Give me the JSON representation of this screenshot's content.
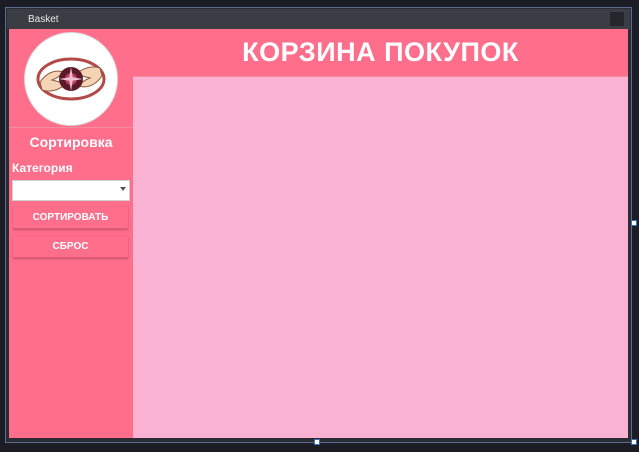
{
  "window": {
    "title": "Basket"
  },
  "sidebar": {
    "logo_icon": "hands-eye-logo",
    "sort_heading": "Сортировка",
    "category_label": "Категория",
    "category_select": {
      "value": ""
    },
    "sort_button": "СОРТИРОВАТЬ",
    "reset_button": "СБРОС"
  },
  "header": {
    "title": "КОРЗИНА ПОКУПОК"
  },
  "colors": {
    "accent": "#ff6f8c",
    "content_bg": "#f9b2d2",
    "text": "#ffffff"
  }
}
